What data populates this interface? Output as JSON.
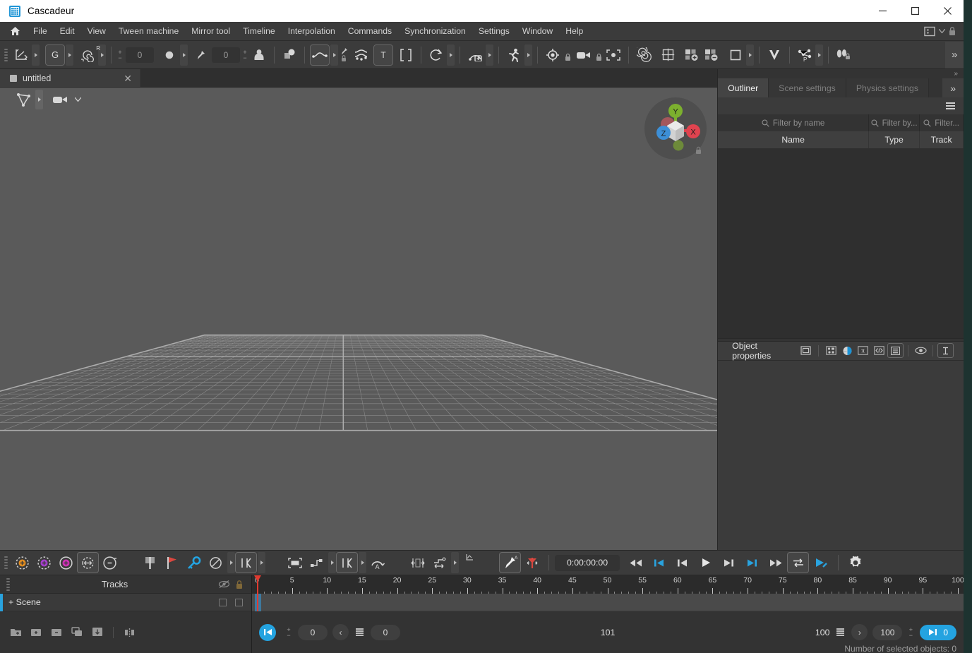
{
  "window": {
    "app_name": "Cascadeur",
    "minimize": "minimize-icon",
    "maximize": "maximize-icon",
    "close": "close-icon"
  },
  "menubar": {
    "home_icon": "home-icon",
    "items": [
      {
        "label": "File"
      },
      {
        "label": "Edit"
      },
      {
        "label": "View"
      },
      {
        "label": "Tween machine"
      },
      {
        "label": "Mirror tool"
      },
      {
        "label": "Timeline"
      },
      {
        "label": "Interpolation"
      },
      {
        "label": "Commands"
      },
      {
        "label": "Synchronization"
      },
      {
        "label": "Settings"
      },
      {
        "label": "Window"
      },
      {
        "label": "Help"
      }
    ],
    "right_icons": [
      "layout-preset-icon",
      "chevron-down-icon",
      "lock-icon"
    ]
  },
  "toolbar": {
    "items": [
      {
        "name": "axis-transform-icon",
        "value": null
      },
      {
        "name": "global-coords-icon",
        "value": null
      },
      {
        "name": "rotation-ref-icon",
        "value": null
      },
      {
        "name": "spiral-snap-icon",
        "value": null
      },
      {
        "name": "point-size-field",
        "value": "0"
      },
      {
        "name": "dot-size-icon",
        "value": null
      },
      {
        "name": "pin-size-field",
        "value": "0"
      },
      {
        "name": "character-icon",
        "value": null
      },
      {
        "name": "copy-pose-icon",
        "value": null
      },
      {
        "name": "curve-smooth-icon",
        "value": null
      },
      {
        "name": "retime-icon",
        "value": null
      },
      {
        "name": "text-tool-icon",
        "value": null
      },
      {
        "name": "brackets-icon",
        "value": null
      },
      {
        "name": "rotate-loop-icon",
        "value": null
      },
      {
        "name": "add-physics-icon",
        "value": null
      },
      {
        "name": "running-man-icon",
        "value": null
      },
      {
        "name": "target-icon",
        "value": null
      },
      {
        "name": "camera-icon",
        "value": null
      },
      {
        "name": "fit-view-icon",
        "value": null
      },
      {
        "name": "spiral-icon",
        "value": null
      },
      {
        "name": "grid-icon",
        "value": null
      },
      {
        "name": "add-layer-icon",
        "value": null
      },
      {
        "name": "remove-layer-icon",
        "value": null
      },
      {
        "name": "square-select-icon",
        "value": null
      },
      {
        "name": "chevron-shape-icon",
        "value": null
      },
      {
        "name": "physics-point-icon",
        "value": null
      },
      {
        "name": "footsteps-lock-icon",
        "value": null
      }
    ],
    "overflow_label": "»"
  },
  "document_tab": {
    "label": "untitled",
    "close_label": "✕"
  },
  "viewport": {
    "tools": [
      "selection-shape-icon",
      "camera-view-icon"
    ],
    "gizmo": {
      "axis_x": "X",
      "axis_y": "Y",
      "axis_z": "Z",
      "lock_icon": "lock-icon"
    },
    "background_color": "#5a5a5a",
    "grid_color": "#9a9a9a"
  },
  "right_panel": {
    "tabs": [
      {
        "label": "Outliner",
        "active": true
      },
      {
        "label": "Scene settings",
        "active": false
      },
      {
        "label": "Physics settings",
        "active": false
      }
    ],
    "tabs_overflow": "»",
    "menu_icon": "hamburger-icon",
    "filters": [
      {
        "placeholder": "Filter by name",
        "value": ""
      },
      {
        "placeholder": "Filter by...",
        "value": ""
      },
      {
        "placeholder": "Filter...",
        "value": ""
      }
    ],
    "columns": [
      "Name",
      "Type",
      "Track"
    ],
    "rows": [],
    "object_properties": {
      "title": "Object properties",
      "icons": [
        "window-icon",
        "node-graph-icon",
        "color-swatch-icon",
        "pi-constant-icon",
        "code-brackets-icon",
        "list-view-icon",
        "visibility-icon",
        "text-tool-icon"
      ],
      "accent_color": "#29a3df"
    }
  },
  "bottom_toolbar": {
    "left_icons": [
      "orange-ghost-icon",
      "purple-ghost-icon",
      "magenta-ghost-icon",
      "ghost-range-icon",
      "ghost-remove-icon",
      "pin-marker-icon",
      "red-flag-icon",
      "key-icon",
      "no-interp-icon",
      "ik-mode-icon",
      "box-select-icon",
      "step-interp-icon",
      "ik-fk-icon",
      "auto-arc-icon",
      "mirror-range-icon",
      "ease-curve-icon",
      "graph-small-icon",
      "pin-tool-icon",
      "red-pin-icon"
    ],
    "timecode": "0:00:00:00",
    "transport": [
      "rewind-icon",
      "skip-start-icon",
      "prev-frame-icon",
      "play-icon",
      "next-frame-icon",
      "skip-end-icon",
      "fast-forward-icon",
      "loop-icon",
      "play-range-icon"
    ],
    "settings_icon": "gear-icon",
    "accent_color": "#29a3df"
  },
  "tracks_panel": {
    "header_title": "Tracks",
    "header_icons": [
      "eye-off-icon",
      "lock-icon"
    ],
    "rows": [
      {
        "label": "+ Scene",
        "checkbox1": false,
        "checkbox2": false
      }
    ],
    "footer_icons": [
      "new-folder-icon",
      "add-track-icon",
      "remove-track-icon",
      "duplicate-track-icon",
      "import-track-icon",
      "mirror-track-icon"
    ]
  },
  "timeline": {
    "ruler_labels": [
      "0",
      "5",
      "10",
      "15",
      "20",
      "25",
      "30",
      "35",
      "40",
      "45",
      "50",
      "55",
      "60",
      "65",
      "70",
      "75",
      "80",
      "85",
      "90",
      "95",
      "100"
    ],
    "range_start": 0,
    "range_end": 100,
    "playhead_frame": 0,
    "controls": {
      "start_key_icon": "skip-start-icon",
      "start_plusminus": "+/-",
      "start_value": "0",
      "prev_chevron": "‹",
      "left_list_icon": "list-icon",
      "left_value": "0",
      "total_frames": "101",
      "right_value": "100",
      "right_list_icon": "list-icon",
      "next_chevron": "›",
      "end_value": "100",
      "end_plusminus": "+/-",
      "end_pill_icon": "skip-end-icon",
      "end_pill_value": "0"
    }
  },
  "status": {
    "selected_objects_text": "Number of selected objects: 0"
  }
}
